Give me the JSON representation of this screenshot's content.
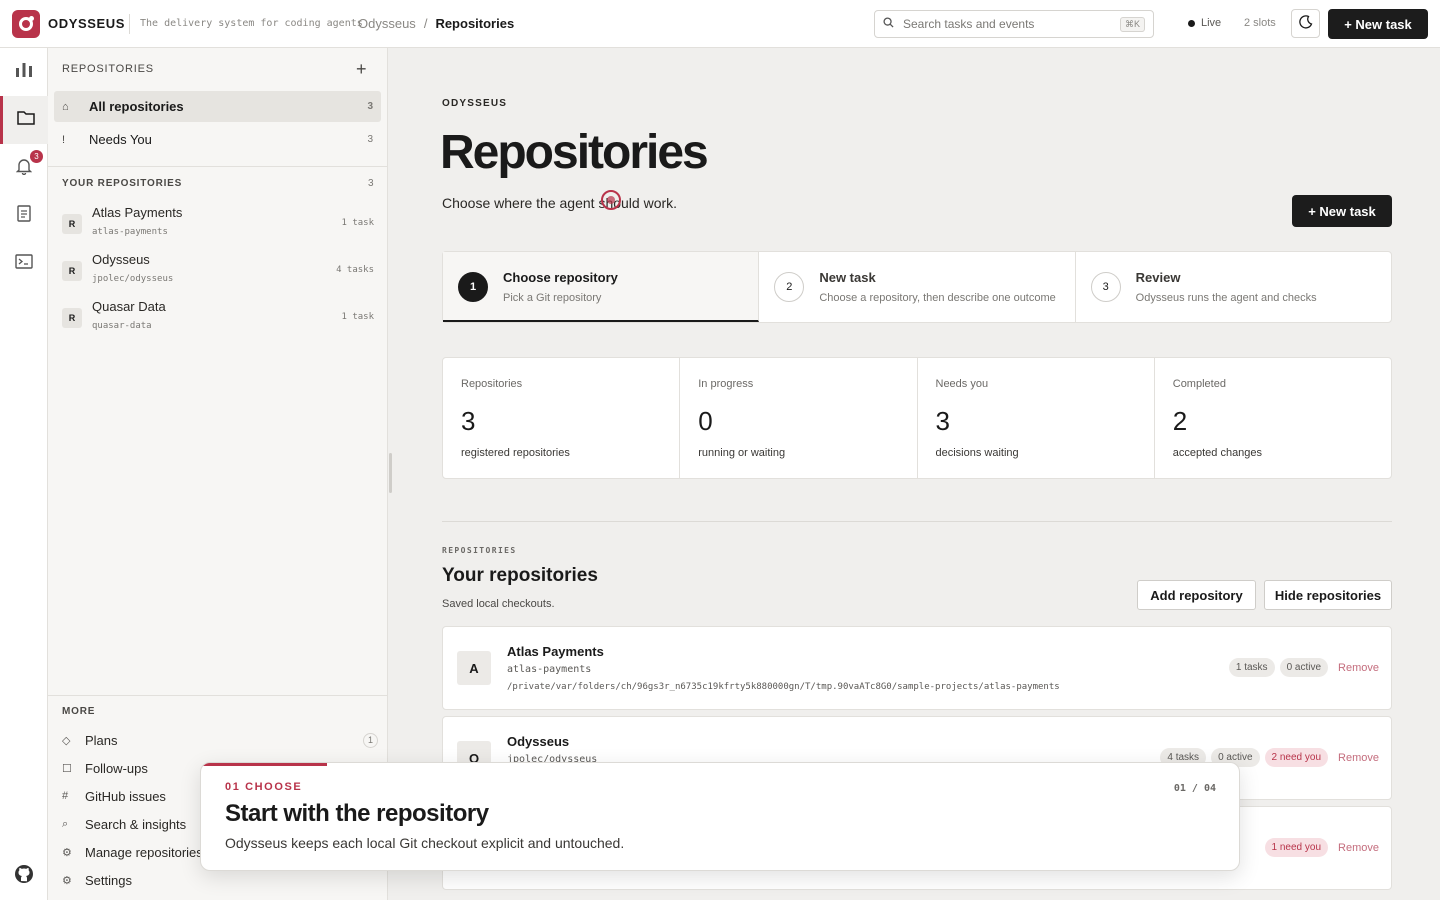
{
  "app": {
    "brand": "ODYSSEUS",
    "tagline": "The delivery system for coding agents"
  },
  "breadcrumb": {
    "root": "Odysseus",
    "sep": "/",
    "current": "Repositories"
  },
  "search": {
    "placeholder": "Search tasks and events",
    "shortcut": "⌘K"
  },
  "status": {
    "live": "Live",
    "slots": "2 slots"
  },
  "topbar": {
    "new_task": "+ New task"
  },
  "rail": {
    "notifications_badge": "3"
  },
  "sidebar": {
    "title": "REPOSITORIES",
    "nav": [
      {
        "glyph": "⌂",
        "label": "All repositories",
        "count": "3"
      },
      {
        "glyph": "!",
        "label": "Needs You",
        "count": "3"
      }
    ],
    "your_title": "YOUR REPOSITORIES",
    "your_count": "3",
    "repos": [
      {
        "initial": "R",
        "name": "Atlas Payments",
        "slug": "atlas-payments",
        "tasks": "1 task"
      },
      {
        "initial": "R",
        "name": "Odysseus",
        "slug": "jpolec/odysseus",
        "tasks": "4 tasks"
      },
      {
        "initial": "R",
        "name": "Quasar Data",
        "slug": "quasar-data",
        "tasks": "1 task"
      }
    ],
    "more_title": "MORE",
    "more": [
      {
        "glyph": "◇",
        "label": "Plans",
        "count": "1"
      },
      {
        "glyph": "☐",
        "label": "Follow-ups"
      },
      {
        "glyph": "#",
        "label": "GitHub issues"
      },
      {
        "glyph": "⌕",
        "label": "Search & insights"
      },
      {
        "glyph": "⚙",
        "label": "Manage repositories"
      },
      {
        "glyph": "⚙",
        "label": "Settings"
      }
    ]
  },
  "main": {
    "eyebrow": "ODYSSEUS",
    "title": "Repositories",
    "subtitle": "Choose where the agent should work.",
    "new_task": "+ New task",
    "steps": [
      {
        "num": "1",
        "title": "Choose repository",
        "desc": "Pick a Git repository"
      },
      {
        "num": "2",
        "title": "New task",
        "desc": "Choose a repository, then describe one outcome"
      },
      {
        "num": "3",
        "title": "Review",
        "desc": "Odysseus runs the agent and checks"
      }
    ],
    "stats": [
      {
        "label": "Repositories",
        "value": "3",
        "desc": "registered repositories"
      },
      {
        "label": "In progress",
        "value": "0",
        "desc": "running or waiting"
      },
      {
        "label": "Needs you",
        "value": "3",
        "desc": "decisions waiting"
      },
      {
        "label": "Completed",
        "value": "2",
        "desc": "accepted changes"
      }
    ],
    "section": {
      "eyebrow": "REPOSITORIES",
      "title": "Your repositories",
      "subtitle": "Saved local checkouts.",
      "add": "Add repository",
      "hide": "Hide repositories"
    },
    "cards": [
      {
        "initial": "A",
        "name": "Atlas Payments",
        "slug": "atlas-payments",
        "path": "/private/var/folders/ch/96gs3r_n6735c19kfrty5k880000gn/T/tmp.90vaATc8G0/sample-projects/atlas-payments",
        "tasks": "1 tasks",
        "active": "0 active",
        "remove": "Remove"
      },
      {
        "initial": "O",
        "name": "Odysseus",
        "slug": "jpolec/odysseus",
        "tasks": "4 tasks",
        "active": "0 active",
        "need": "2 need you",
        "remove": "Remove"
      },
      {
        "need": "1 need you",
        "remove": "Remove"
      }
    ]
  },
  "tour": {
    "step": "01 CHOOSE",
    "page": "01 / 04",
    "title": "Start with the repository",
    "body": "Odysseus keeps each local Git checkout explicit and untouched."
  }
}
